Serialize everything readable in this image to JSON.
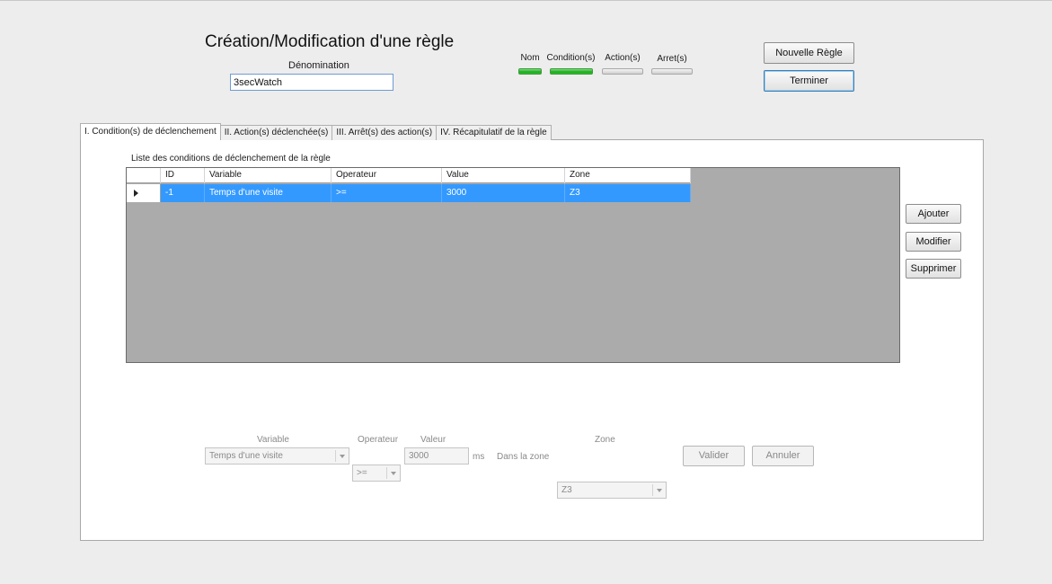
{
  "header": {
    "title": "Création/Modification d'une règle",
    "denomination_label": "Dénomination",
    "denomination_value": "3secWatch"
  },
  "status": [
    {
      "label": "Nom",
      "state": "on"
    },
    {
      "label": "Condition(s)",
      "state": "on"
    },
    {
      "label": "Action(s)",
      "state": "off"
    },
    {
      "label": "Arret(s)",
      "state": "off"
    }
  ],
  "status_colors": {
    "on": "#1fa91f",
    "off": "#d4d4d4"
  },
  "actions": {
    "new_rule": "Nouvelle Règle",
    "finish": "Terminer"
  },
  "tabs": [
    {
      "label": "I. Condition(s) de déclenchement",
      "active": true
    },
    {
      "label": "II. Action(s) déclenchée(s)",
      "active": false
    },
    {
      "label": "III. Arrêt(s) des action(s)",
      "active": false
    },
    {
      "label": "IV. Récapitulatif de la règle",
      "active": false
    }
  ],
  "conditions": {
    "list_label": "Liste des conditions de déclenchement de la règle",
    "columns": [
      "ID",
      "Variable",
      "Operateur",
      "Value",
      "Zone"
    ],
    "rows": [
      {
        "id": "-1",
        "variable": "Temps d'une visite",
        "operateur": ">=",
        "value": "3000",
        "zone": "Z3"
      }
    ],
    "selection_color": "#3399ff"
  },
  "side_buttons": {
    "add": "Ajouter",
    "modify": "Modifier",
    "delete": "Supprimer"
  },
  "editor": {
    "variable_label": "Variable",
    "variable_value": "Temps d'une visite",
    "operateur_label": "Operateur",
    "operateur_value": ">=",
    "valeur_label": "Valeur",
    "valeur_value": "3000",
    "unit": "ms",
    "dans_la_zone": "Dans la zone",
    "zone_label": "Zone",
    "zone_value": "Z3",
    "validate": "Valider",
    "cancel": "Annuler"
  }
}
